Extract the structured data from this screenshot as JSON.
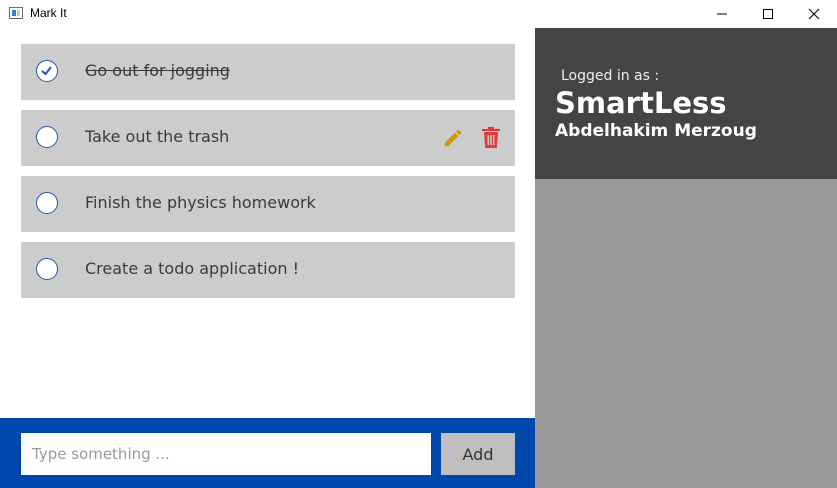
{
  "window": {
    "title": "Mark It",
    "icon": "app-window-icon",
    "controls": [
      "minimize-icon",
      "maximize-icon",
      "close-icon"
    ]
  },
  "tasks": [
    {
      "text": "Go out for jogging",
      "completed": true
    },
    {
      "text": "Take out the trash",
      "completed": false,
      "actions": [
        "pencil-icon",
        "trash-icon"
      ]
    },
    {
      "text": "Finish the physics homework",
      "completed": false
    },
    {
      "text": "Create a todo application !",
      "completed": false
    }
  ],
  "profile": {
    "logged_in_label": "Logged in as :",
    "brand": "SmartLess",
    "username": "Abdelhakim Merzoug"
  },
  "composer": {
    "placeholder": "Type something ...",
    "value": "",
    "add_label": "Add"
  },
  "colors": {
    "accent_blue": "#0047ab",
    "check_border": "#1f5aa6",
    "task_bg": "#cccccc",
    "edit": "#d4950b",
    "delete": "#e53935",
    "profile_bg": "#444444",
    "sidebar_bg": "#9a9a9a"
  }
}
